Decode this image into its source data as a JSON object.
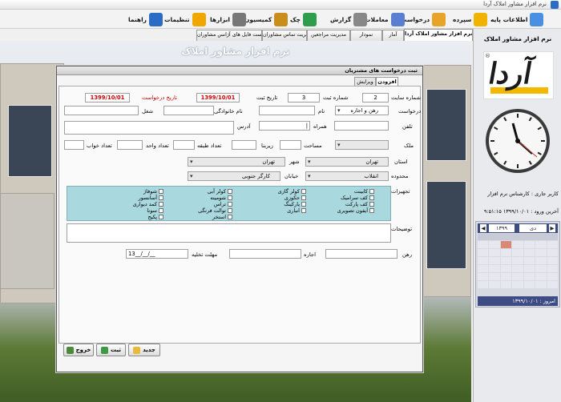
{
  "window": {
    "title": "نرم افزار مشاور املاک آردا"
  },
  "toolbar": [
    {
      "label": "اطلاعات پایه",
      "color": "#4a90e2",
      "icon": "database-icon"
    },
    {
      "label": "سپرده",
      "color": "#f0b400",
      "icon": "folder-icon"
    },
    {
      "label": "درخواست",
      "color": "#e8a32b",
      "icon": "folder-open-icon"
    },
    {
      "label": "معاملات",
      "color": "#5a7fd1",
      "icon": "pen-icon"
    },
    {
      "label": "گزارش",
      "color": "#888888",
      "icon": "magnifier-icon"
    },
    {
      "label": "چک",
      "color": "#2e9e4d",
      "icon": "check-icon"
    },
    {
      "label": "کمیسیون",
      "color": "#c98d1b",
      "icon": "money-icon"
    },
    {
      "label": "ابزارها",
      "color": "#777777",
      "icon": "tools-icon"
    },
    {
      "label": "تنظیمات",
      "color": "#f0a800",
      "icon": "gear-icon"
    },
    {
      "label": "راهنما",
      "color": "#2b6cc4",
      "icon": "help-icon"
    }
  ],
  "tabs": [
    "نرم افزار مشاور املاک آردا",
    "آمار",
    "نمودار",
    "مدیریت مراجعین",
    "مدیریت تماس مشاوران",
    "لیست فایل های آژانس مشاوران"
  ],
  "side": {
    "title": "نرم افزار مشاور املاک",
    "logo": "آردا",
    "license": "کاربر جاری : کارشناس نرم افزار",
    "last_login": "آخرین ورود : ۱۳۹۹/۱۰/۰۱ ۹:۵۱:۱۵",
    "cal_month": "دی",
    "cal_year": "۱۳۹۹",
    "today": "امروز : ۱۳۹۹/۱۰/۰۱"
  },
  "scene": {
    "title": "نرم افزار مشاور املاک"
  },
  "dialog": {
    "title": "ثبت درخواست های مشتریان",
    "tabs": [
      "افزودن",
      "ویرایش"
    ],
    "fields": {
      "site_no_label": "شماره سایت",
      "site_no": "2",
      "reg_no_label": "شماره ثبت",
      "reg_no": "3",
      "reg_date_label": "تاریخ ثبت",
      "reg_date": "1399/10/01",
      "req_date_label": "تاریخ درخواست",
      "req_date": "1399/10/01",
      "request_label": "درخواست",
      "request_value": "رهن و اجاره",
      "name_label": "نام",
      "family_label": "نام خانوادگی",
      "job_label": "شغل",
      "phone_label": "تلفن",
      "mobile_label": "همراه",
      "address_label": "آدرس",
      "property_label": "ملک",
      "area_label": "مساحت",
      "infra_label": "زیربنا",
      "floors_label": "تعداد طبقه",
      "units_label": "تعداد واحد",
      "beds_label": "تعداد خواب",
      "province_label": "استان",
      "province_value": "تهران",
      "city_label": "شهر",
      "city_value": "تهران",
      "region_label": "محدوده",
      "region_value": "انقلاب",
      "street_label": "خیابان",
      "street_value": "کارگر جنوبی",
      "facilities_label": "تجهیزات",
      "desc_label": "توضیحات",
      "deposit_label": "رهن",
      "rent_label": "اجاره",
      "vacate_label": "مهلت تخلیه",
      "vacate_value": "13__/__/__"
    },
    "facilities": [
      [
        "کابینت",
        "کولر گازی",
        "کولر آبی",
        "شوفاژ"
      ],
      [
        "کف سرامیک",
        "حکوزی",
        "شومینه",
        "شوفاژ"
      ],
      [
        "کف پارکت",
        "پارکینگ",
        "تراس",
        "کمد دیواری"
      ],
      [
        "آیفون تصویری",
        "انباری",
        "توالت فرنگی",
        "آسانسور"
      ],
      [
        "",
        "",
        "استخر",
        "سونا"
      ],
      [
        "",
        "",
        "",
        "پکیج"
      ]
    ],
    "facility_grid": [
      [
        "کابینت",
        "کولر گازی",
        "کولر آبی",
        "شوفاژ"
      ],
      [
        "کف سرامیک",
        "حکوزی",
        "شومینه",
        "آسانسور"
      ],
      [
        "کف پارکت",
        "پارکینگ",
        "تراس",
        "کمد دیواری"
      ],
      [
        "آیفون تصویری",
        "انباری",
        "توالت فرنگی",
        "سونا"
      ],
      [
        "",
        "",
        "استخر",
        "پکیج"
      ]
    ],
    "buttons": {
      "new": "جدید",
      "save": "ثبت",
      "exit": "خروج"
    }
  }
}
